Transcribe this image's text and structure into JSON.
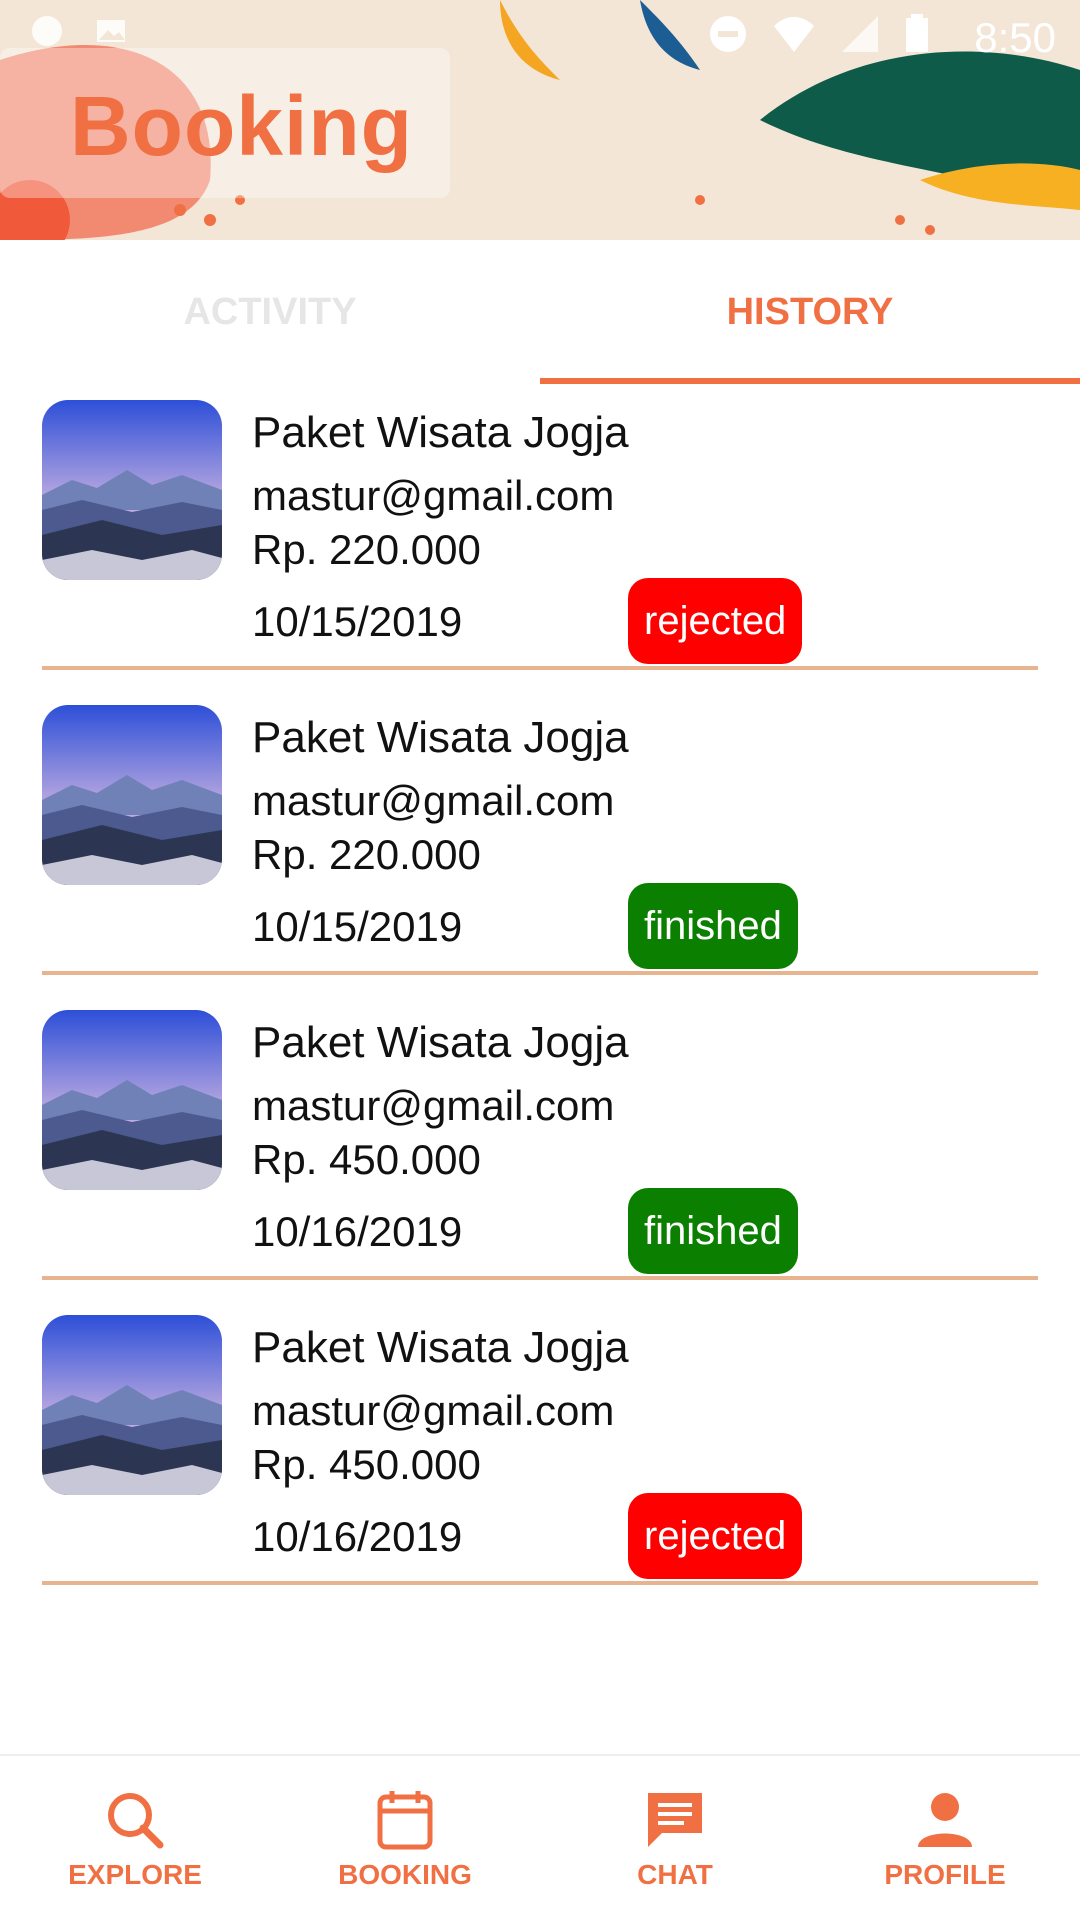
{
  "status": {
    "time": "8:50"
  },
  "header": {
    "title": "Booking"
  },
  "tabs": [
    {
      "label": "ACTIVITY",
      "active": false
    },
    {
      "label": "HISTORY",
      "active": true
    }
  ],
  "history": [
    {
      "name": "Paket Wisata Jogja",
      "email": "mastur@gmail.com",
      "price": "Rp. 220.000",
      "date": "10/15/2019",
      "status": "rejected",
      "status_color": "#ff0000"
    },
    {
      "name": "Paket Wisata Jogja",
      "email": "mastur@gmail.com",
      "price": "Rp. 220.000",
      "date": "10/15/2019",
      "status": "finished",
      "status_color": "#0a7f00"
    },
    {
      "name": "Paket Wisata Jogja",
      "email": "mastur@gmail.com",
      "price": "Rp. 450.000",
      "date": "10/16/2019",
      "status": "finished",
      "status_color": "#0a7f00"
    },
    {
      "name": "Paket Wisata Jogja",
      "email": "mastur@gmail.com",
      "price": "Rp. 450.000",
      "date": "10/16/2019",
      "status": "rejected",
      "status_color": "#ff0000"
    }
  ],
  "nav": [
    {
      "label": "EXPLORE",
      "icon": "search-icon"
    },
    {
      "label": "BOOKING",
      "icon": "calendar-icon"
    },
    {
      "label": "CHAT",
      "icon": "chat-icon"
    },
    {
      "label": "PROFILE",
      "icon": "person-icon"
    }
  ],
  "colors": {
    "accent": "#f07043",
    "divider": "#e7b48f",
    "rejected": "#ff0000",
    "finished": "#0a7f00"
  }
}
